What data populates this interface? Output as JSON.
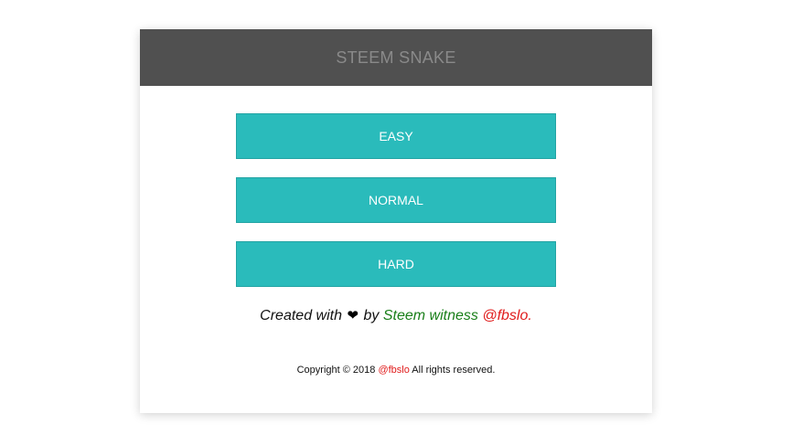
{
  "header": {
    "title": "STEEM SNAKE"
  },
  "menu": {
    "buttons": [
      {
        "label": "EASY"
      },
      {
        "label": "NORMAL"
      },
      {
        "label": "HARD"
      }
    ]
  },
  "credit": {
    "prefix": "Created with",
    "heart_icon": "heart-icon",
    "by": "by",
    "witness_text": "Steem witness",
    "handle": "@fbslo."
  },
  "footer": {
    "copyright_prefix": "Copyright © 2018",
    "handle": "@fbslo",
    "suffix": "All rights reserved."
  },
  "colors": {
    "header_bg": "#505050",
    "button_bg": "#2abbbb",
    "green": "#1a7f1a",
    "red": "#e01b1b"
  }
}
